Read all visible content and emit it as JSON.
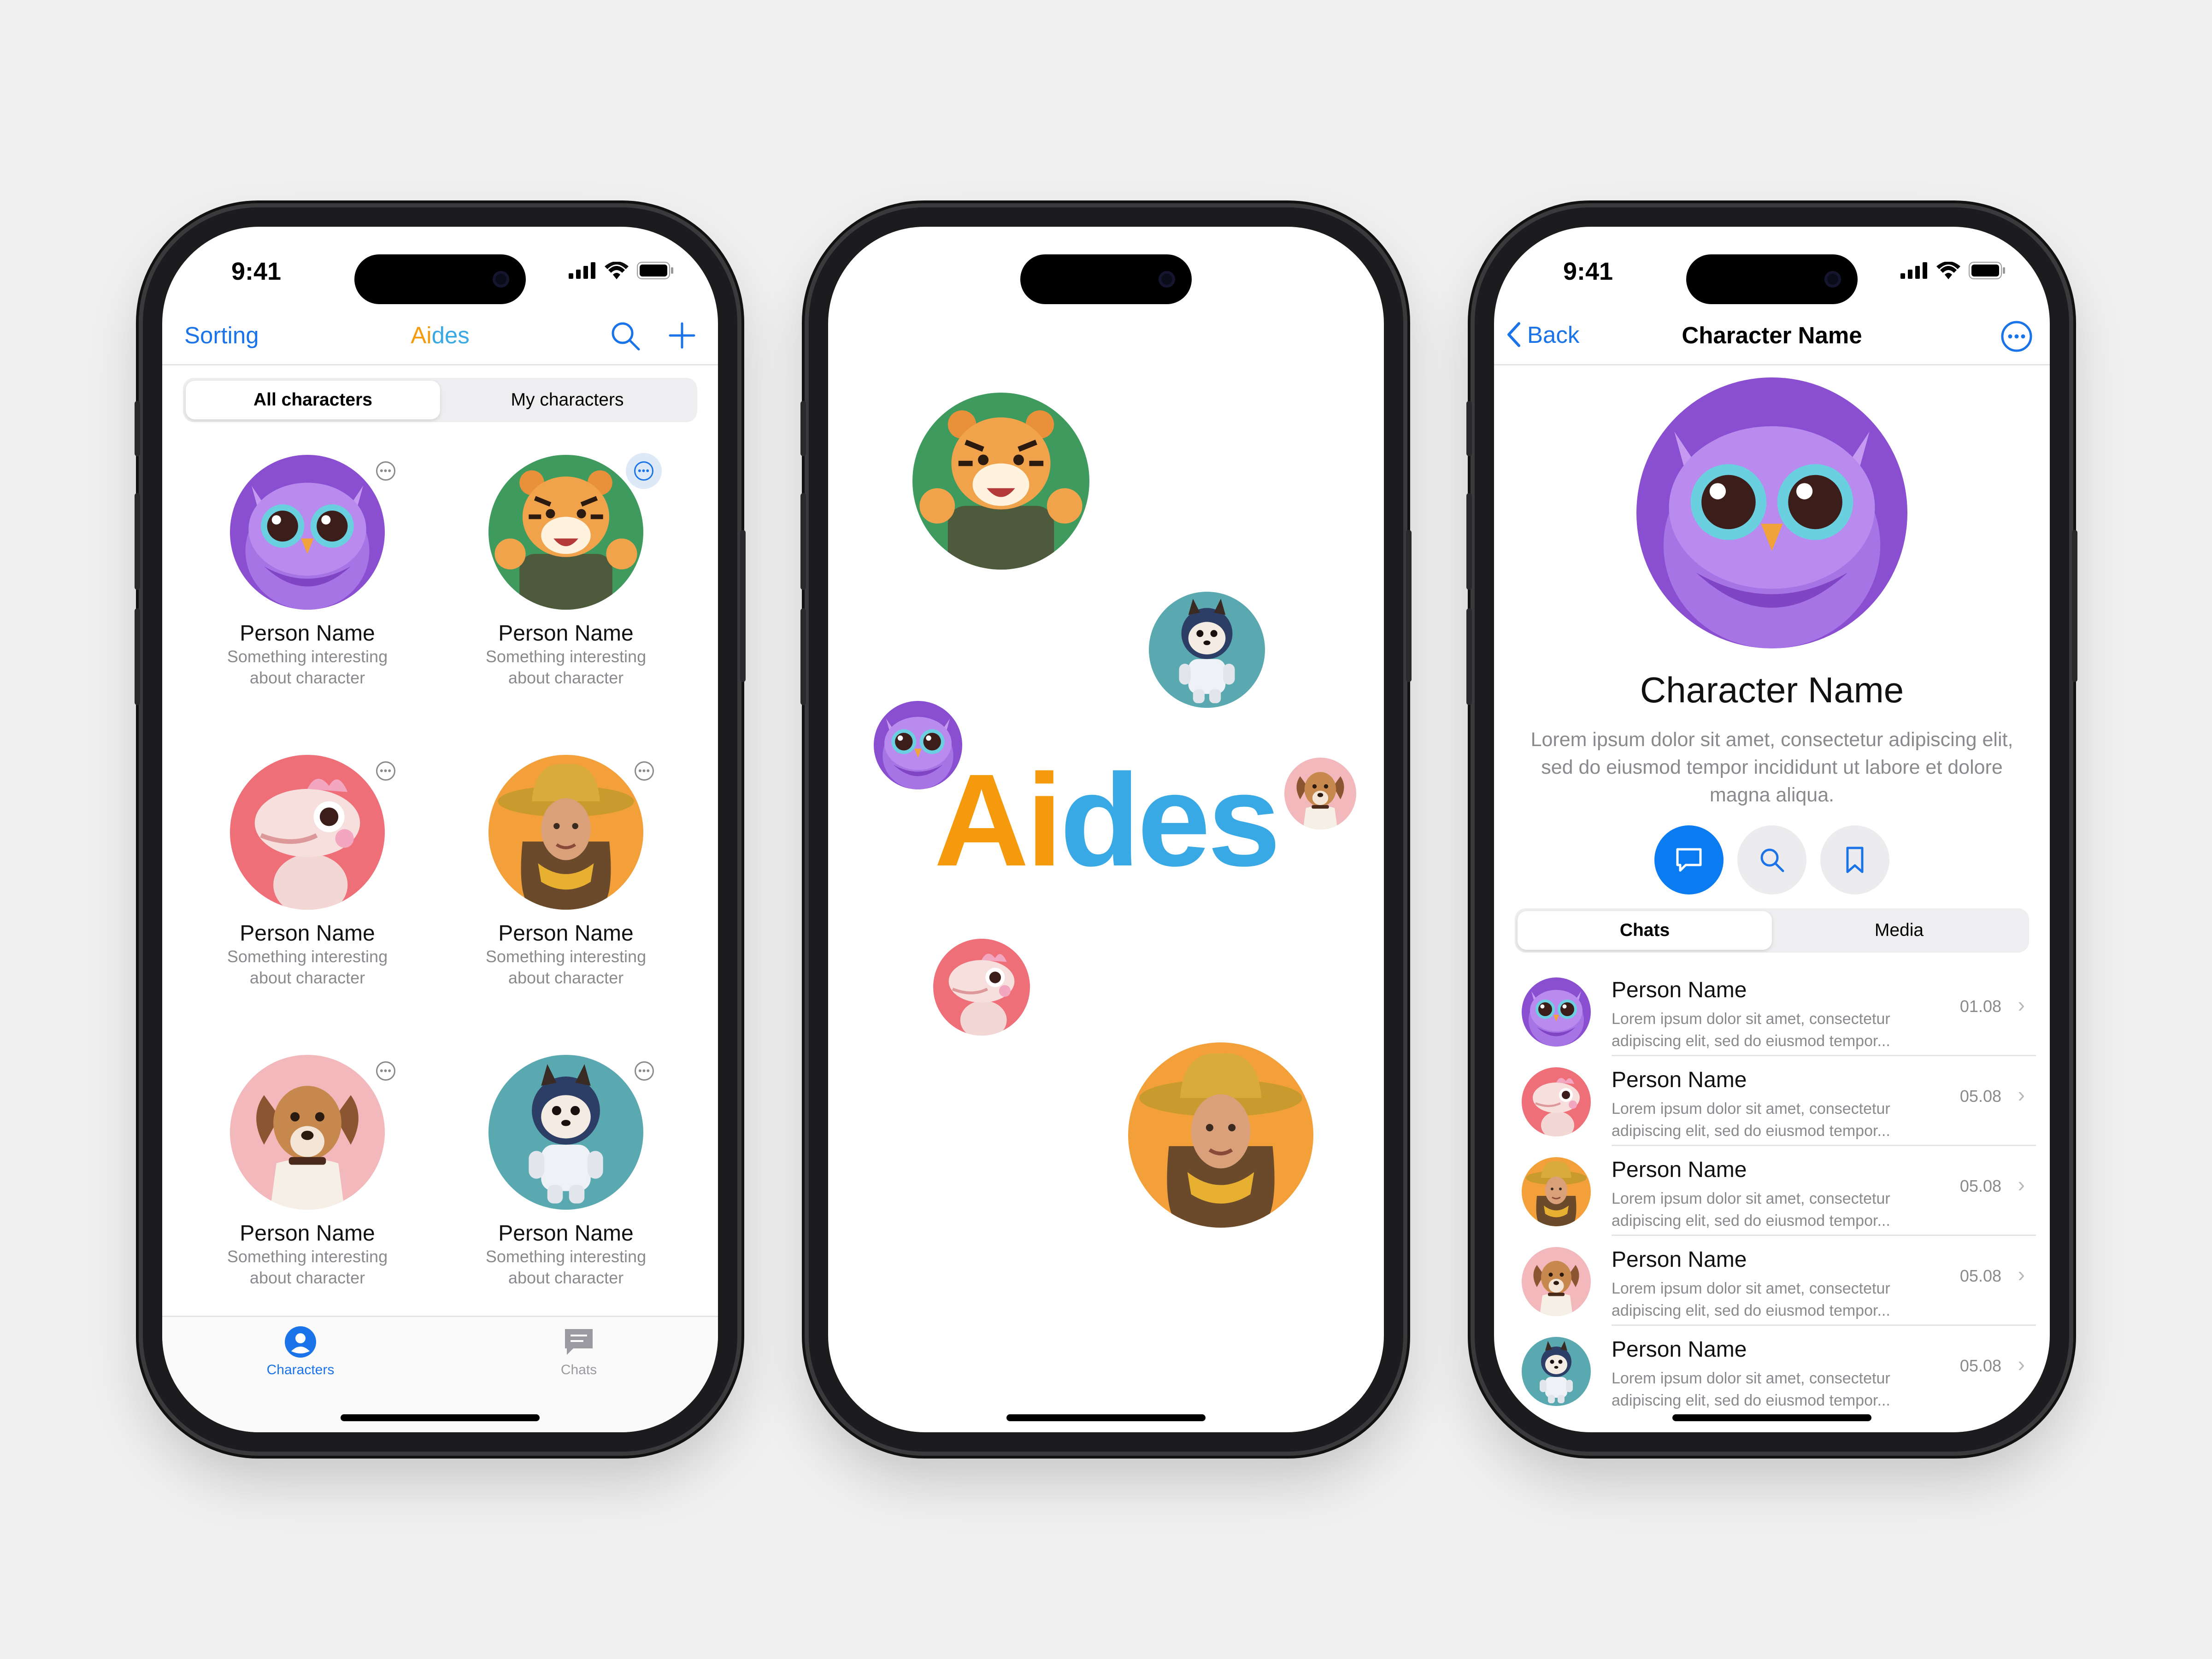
{
  "status": {
    "time": "9:41"
  },
  "screen1": {
    "nav": {
      "left": "Sorting",
      "title_a": "Ai",
      "title_b": "des"
    },
    "segments": [
      "All characters",
      "My characters"
    ],
    "cards": [
      {
        "name": "Person Name",
        "desc1": "Something interesting",
        "desc2": "about character",
        "icon": "owl-avatar"
      },
      {
        "name": "Person Name",
        "desc1": "Something interesting",
        "desc2": "about character",
        "icon": "tiger-avatar"
      },
      {
        "name": "Person Name",
        "desc1": "Something interesting",
        "desc2": "about character",
        "icon": "dino-avatar"
      },
      {
        "name": "Person Name",
        "desc1": "Something interesting",
        "desc2": "about character",
        "icon": "cowgirl-avatar"
      },
      {
        "name": "Person Name",
        "desc1": "Something interesting",
        "desc2": "about character",
        "icon": "dog-avatar"
      },
      {
        "name": "Person Name",
        "desc1": "Something interesting",
        "desc2": "about character",
        "icon": "astro-dog-avatar"
      }
    ],
    "tabs": [
      "Characters",
      "Chats"
    ]
  },
  "screen2": {
    "logo_a": "Ai",
    "logo_b": "des"
  },
  "screen3": {
    "nav": {
      "back": "Back",
      "title": "Character Name"
    },
    "heading": "Character Name",
    "bio": "Lorem ipsum dolor sit amet, consectetur adipiscing elit, sed do eiusmod tempor incididunt ut labore et dolore magna aliqua.",
    "segments": [
      "Chats",
      "Media"
    ],
    "rows": [
      {
        "name": "Person Name",
        "p1": "Lorem ipsum dolor sit amet, consectetur",
        "p2": "adipiscing elit, sed do eiusmod tempor...",
        "date": "01.08"
      },
      {
        "name": "Person Name",
        "p1": "Lorem ipsum dolor sit amet, consectetur",
        "p2": "adipiscing elit, sed do eiusmod tempor...",
        "date": "05.08"
      },
      {
        "name": "Person Name",
        "p1": "Lorem ipsum dolor sit amet, consectetur",
        "p2": "adipiscing elit, sed do eiusmod tempor...",
        "date": "05.08"
      },
      {
        "name": "Person Name",
        "p1": "Lorem ipsum dolor sit amet, consectetur",
        "p2": "adipiscing elit, sed do eiusmod tempor...",
        "date": "05.08"
      },
      {
        "name": "Person Name",
        "p1": "Lorem ipsum dolor sit amet, consectetur",
        "p2": "adipiscing elit, sed do eiusmod tempor...",
        "date": "05.08"
      }
    ]
  },
  "colors": {
    "accent": "#1a73e8",
    "orange": "#f59a0c",
    "logo_blue": "#39a9e6",
    "owl": "#9b5bd6",
    "tiger_bg": "#3f9a5e",
    "dino_bg": "#ef6f78",
    "cowgirl_bg": "#f3a03a",
    "dog_bg": "#f2b8bb",
    "astro_bg": "#5aa8b0"
  }
}
